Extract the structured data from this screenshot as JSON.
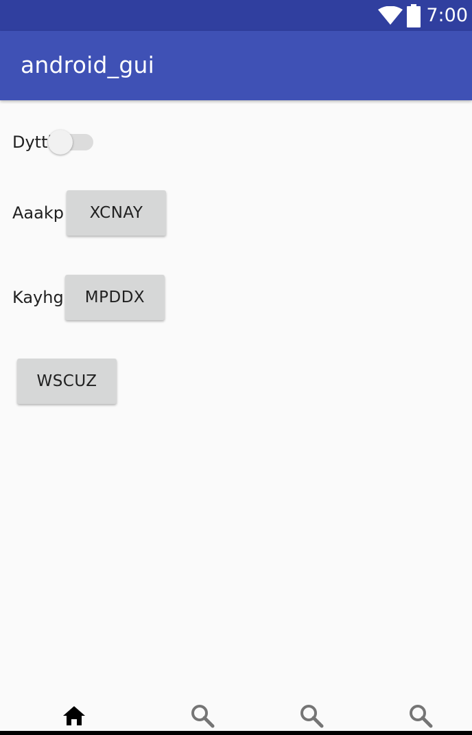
{
  "status_bar": {
    "time": "7:00",
    "wifi_icon": "wifi-icon",
    "battery_icon": "battery-icon"
  },
  "app_bar": {
    "title": "android_gui"
  },
  "content": {
    "switch_row": {
      "label": "Dyttl",
      "checked": false
    },
    "row1": {
      "label": "Aaakp",
      "button_label": "XCNAY"
    },
    "row2": {
      "label": "Kayhg",
      "button_label": "MPDDX"
    },
    "row3": {
      "button_label": "WSCUZ"
    }
  },
  "bottom_nav": {
    "items": [
      {
        "icon": "home-icon",
        "active": true
      },
      {
        "icon": "search-icon",
        "active": false
      },
      {
        "icon": "search-icon",
        "active": false
      },
      {
        "icon": "search-icon",
        "active": false
      }
    ]
  },
  "colors": {
    "status_bar": "#303f9f",
    "app_bar": "#3f51b5",
    "background": "#fafafa",
    "button": "#d6d7d7"
  }
}
